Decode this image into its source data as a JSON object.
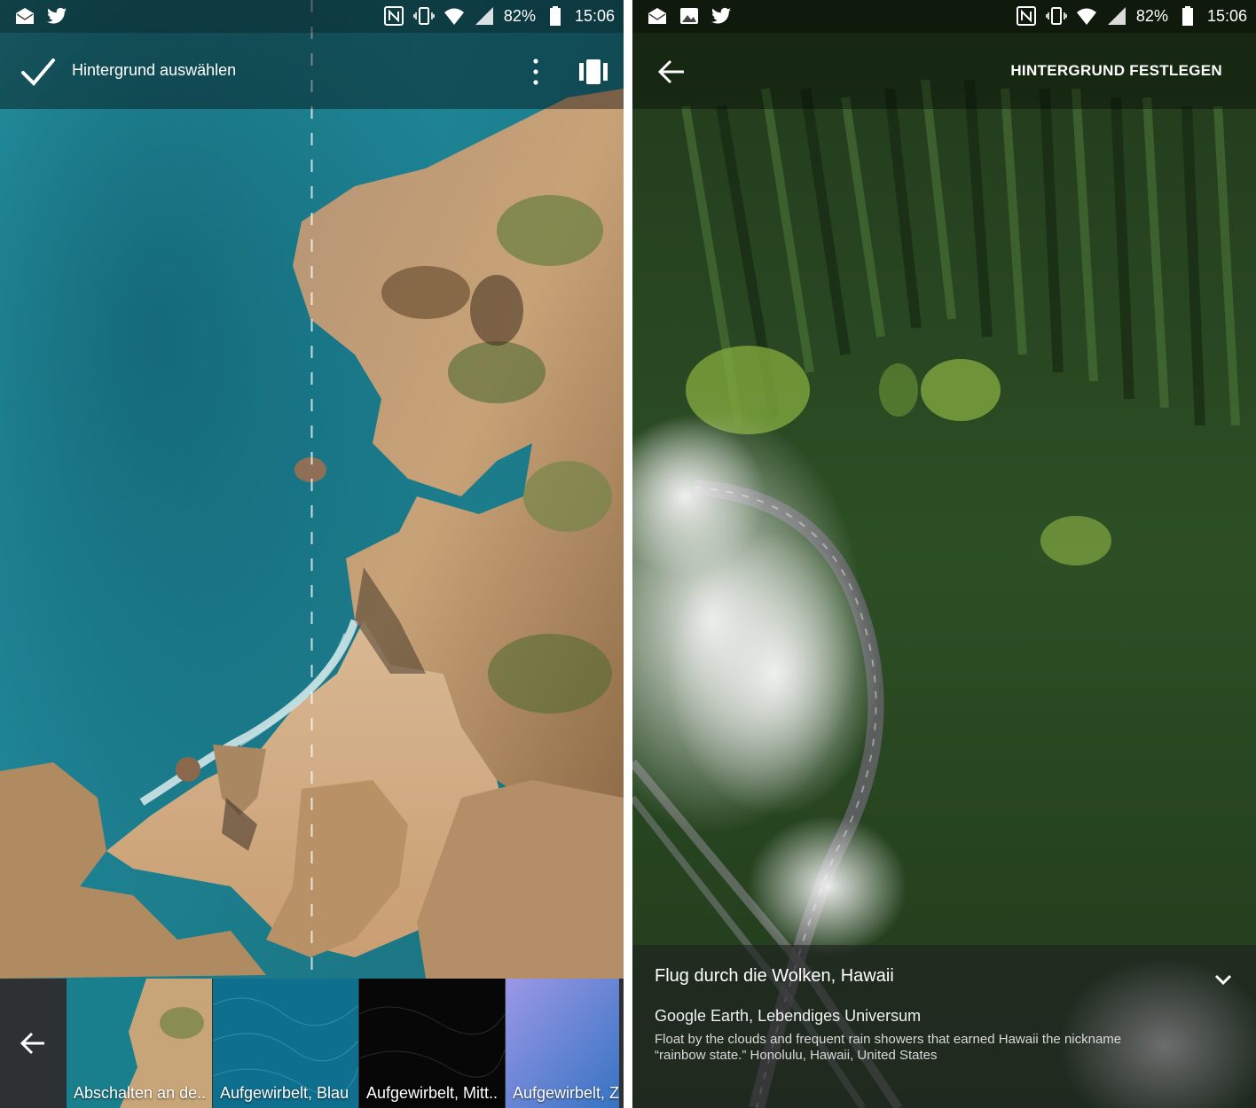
{
  "status_bar": {
    "battery": "82%",
    "time": "15:06",
    "icons_left_screen": [
      "mail-icon",
      "twitter-icon"
    ],
    "icons_right_screen": [
      "mail-icon",
      "image-icon",
      "twitter-icon"
    ],
    "icons_right": [
      "nfc-icon",
      "vibrate-icon",
      "wifi-icon",
      "signal-icon",
      "battery-icon"
    ]
  },
  "left_screen": {
    "toolbar": {
      "title": "Hintergrund auswählen",
      "confirm_icon": "check-icon",
      "menu_icon": "more-vert-icon",
      "scroll_icon": "scroll-preview-icon"
    },
    "wallpapers": [
      {
        "label": "Abschalten an de..",
        "colors": [
          "#1a7f8c",
          "#c8a578"
        ]
      },
      {
        "label": "Aufgewirbelt, Blau",
        "colors": [
          "#0c6c8a",
          "#1e8db0"
        ]
      },
      {
        "label": "Aufgewirbelt, Mitt..",
        "colors": [
          "#050505",
          "#1a1a1a"
        ]
      },
      {
        "label": "Aufgewirbelt, Z",
        "colors": [
          "#8b8fe0",
          "#3b7ec9"
        ]
      }
    ],
    "back_icon": "arrow-left-icon"
  },
  "right_screen": {
    "toolbar": {
      "action": "HINTERGRUND FESTLEGEN",
      "back_icon": "arrow-left-icon"
    },
    "info": {
      "title": "Flug durch die Wolken, Hawaii",
      "subtitle": "Google Earth, Lebendiges Universum",
      "description_line1": "Float by the clouds and frequent rain showers that earned Hawaii the nickname",
      "description_line2": "“rainbow state.” Honolulu, Hawaii, United States",
      "expand_icon": "chevron-down-icon"
    }
  },
  "colors": {
    "sea": "#1f8f99",
    "rock": "#c7a37a",
    "forest": "#2c4a25",
    "strip": "#2e3134"
  }
}
